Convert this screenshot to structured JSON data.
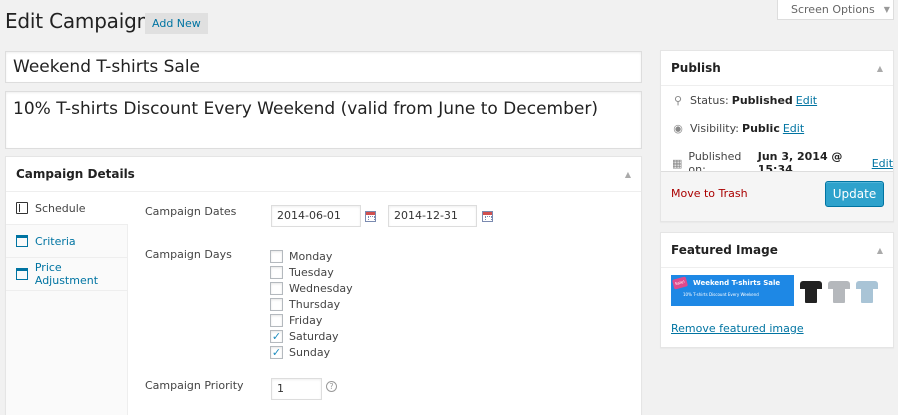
{
  "header": {
    "page_title": "Edit Campaign",
    "add_new_label": "Add New",
    "screen_options_label": "Screen Options"
  },
  "post": {
    "title": "Weekend T-shirts Sale",
    "excerpt": "10% T-shirts Discount Every Weekend (valid from June to December)"
  },
  "campaign_details": {
    "heading": "Campaign Details",
    "tabs": [
      {
        "label": "Schedule",
        "icon": "calendar-icon",
        "active": true
      },
      {
        "label": "Criteria",
        "icon": "window-icon",
        "active": false
      },
      {
        "label": "Price Adjustment",
        "icon": "window-icon",
        "active": false
      }
    ],
    "dates_label": "Campaign Dates",
    "start_date": "2014-06-01",
    "end_date": "2014-12-31",
    "days_label": "Campaign Days",
    "days": [
      {
        "label": "Monday",
        "checked": false
      },
      {
        "label": "Tuesday",
        "checked": false
      },
      {
        "label": "Wednesday",
        "checked": false
      },
      {
        "label": "Thursday",
        "checked": false
      },
      {
        "label": "Friday",
        "checked": false
      },
      {
        "label": "Saturday",
        "checked": true
      },
      {
        "label": "Sunday",
        "checked": true
      }
    ],
    "priority_label": "Campaign Priority",
    "priority_value": "1",
    "help_glyph": "?"
  },
  "publish": {
    "heading": "Publish",
    "status_label": "Status:",
    "status_value": "Published",
    "visibility_label": "Visibility:",
    "visibility_value": "Public",
    "published_label": "Published on:",
    "published_value": "Jun 3, 2014 @ 15:34",
    "edit_label": "Edit",
    "move_to_trash": "Move to Trash",
    "update_label": "Update",
    "update_color": "#2ea2cc"
  },
  "featured_image": {
    "heading": "Featured Image",
    "banner_badge": "Sale!",
    "banner_title": "Weekend T-shirts Sale",
    "banner_subtitle": "10% T-shirts Discount Every Weekend",
    "remove_label": "Remove featured image"
  },
  "colors": {
    "link": "#0074a2",
    "trash": "#aa0000",
    "background": "#f1f1f1"
  }
}
